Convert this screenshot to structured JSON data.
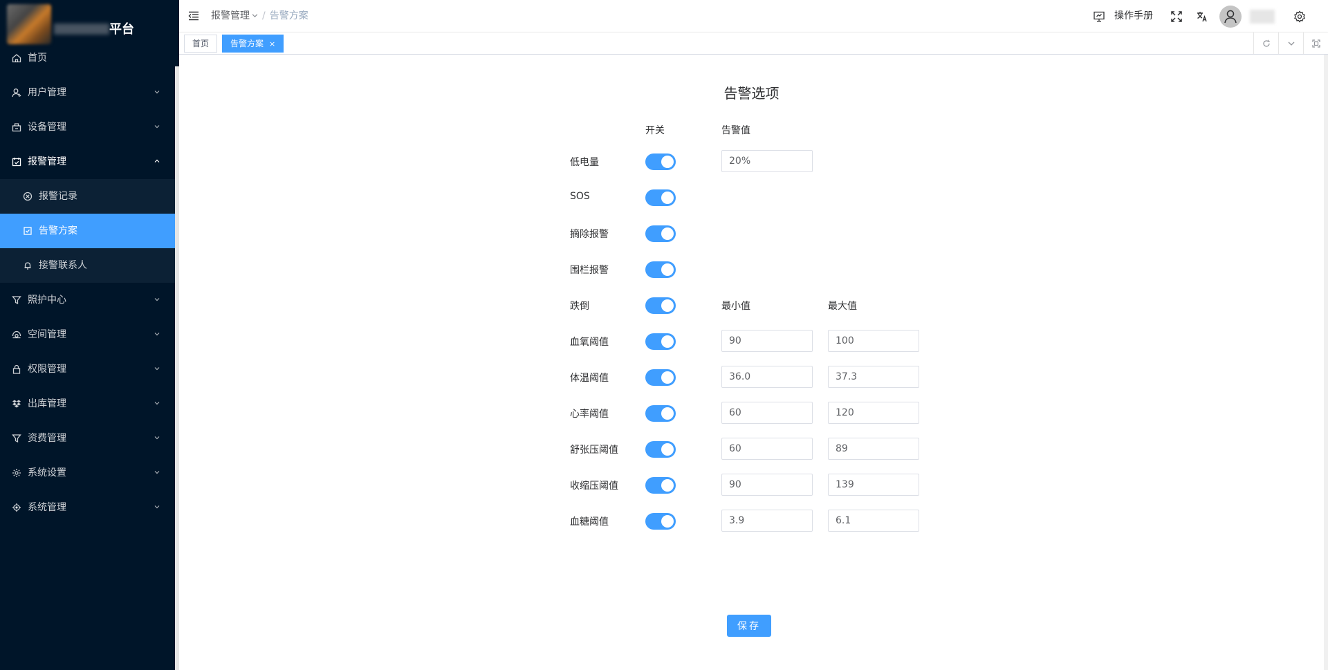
{
  "sidebar": {
    "logo_title": "平台",
    "items": [
      {
        "label": "首页",
        "icon": "home-icon"
      },
      {
        "label": "用户管理",
        "icon": "user-icon"
      },
      {
        "label": "设备管理",
        "icon": "device-icon"
      },
      {
        "label": "报警管理",
        "icon": "alarm-check-icon",
        "expanded": true
      },
      {
        "label": "报警记录",
        "icon": "circle-x-icon"
      },
      {
        "label": "告警方案",
        "icon": "check-square-icon",
        "active": true
      },
      {
        "label": "接警联系人",
        "icon": "bell-icon"
      },
      {
        "label": "照护中心",
        "icon": "filter-icon"
      },
      {
        "label": "空间管理",
        "icon": "space-icon"
      },
      {
        "label": "权限管理",
        "icon": "lock-icon"
      },
      {
        "label": "出库管理",
        "icon": "dropbox-icon"
      },
      {
        "label": "资费管理",
        "icon": "filter-icon"
      },
      {
        "label": "系统设置",
        "icon": "gear-icon"
      },
      {
        "label": "系统管理",
        "icon": "target-icon"
      }
    ]
  },
  "header": {
    "breadcrumb": [
      "报警管理",
      "告警方案"
    ],
    "separator": "/",
    "manual_label": "操作手册"
  },
  "tags": {
    "items": [
      {
        "label": "首页",
        "active": false
      },
      {
        "label": "告警方案",
        "active": true,
        "close": "×"
      }
    ]
  },
  "form": {
    "title": "告警选项",
    "col_switch": "开关",
    "col_alarm_value": "告警值",
    "col_min": "最小值",
    "col_max": "最大值",
    "rows": [
      {
        "label": "低电量",
        "enabled": true,
        "value": "20%"
      },
      {
        "label": "SOS",
        "enabled": true
      },
      {
        "label": "摘除报警",
        "enabled": true
      },
      {
        "label": "围栏报警",
        "enabled": true
      },
      {
        "label": "跌倒",
        "enabled": true
      },
      {
        "label": "血氧阈值",
        "enabled": true,
        "min": "90",
        "max": "100"
      },
      {
        "label": "体温阈值",
        "enabled": true,
        "min": "36.0",
        "max": "37.3"
      },
      {
        "label": "心率阈值",
        "enabled": true,
        "min": "60",
        "max": "120"
      },
      {
        "label": "舒张压阈值",
        "enabled": true,
        "min": "60",
        "max": "89"
      },
      {
        "label": "收缩压阈值",
        "enabled": true,
        "min": "90",
        "max": "139"
      },
      {
        "label": "血糖阈值",
        "enabled": true,
        "min": "3.9",
        "max": "6.1"
      }
    ],
    "save_label": "保存"
  },
  "colors": {
    "sidebar_bg": "#001529",
    "submenu_bg": "#0c2135",
    "accent": "#409eff"
  }
}
